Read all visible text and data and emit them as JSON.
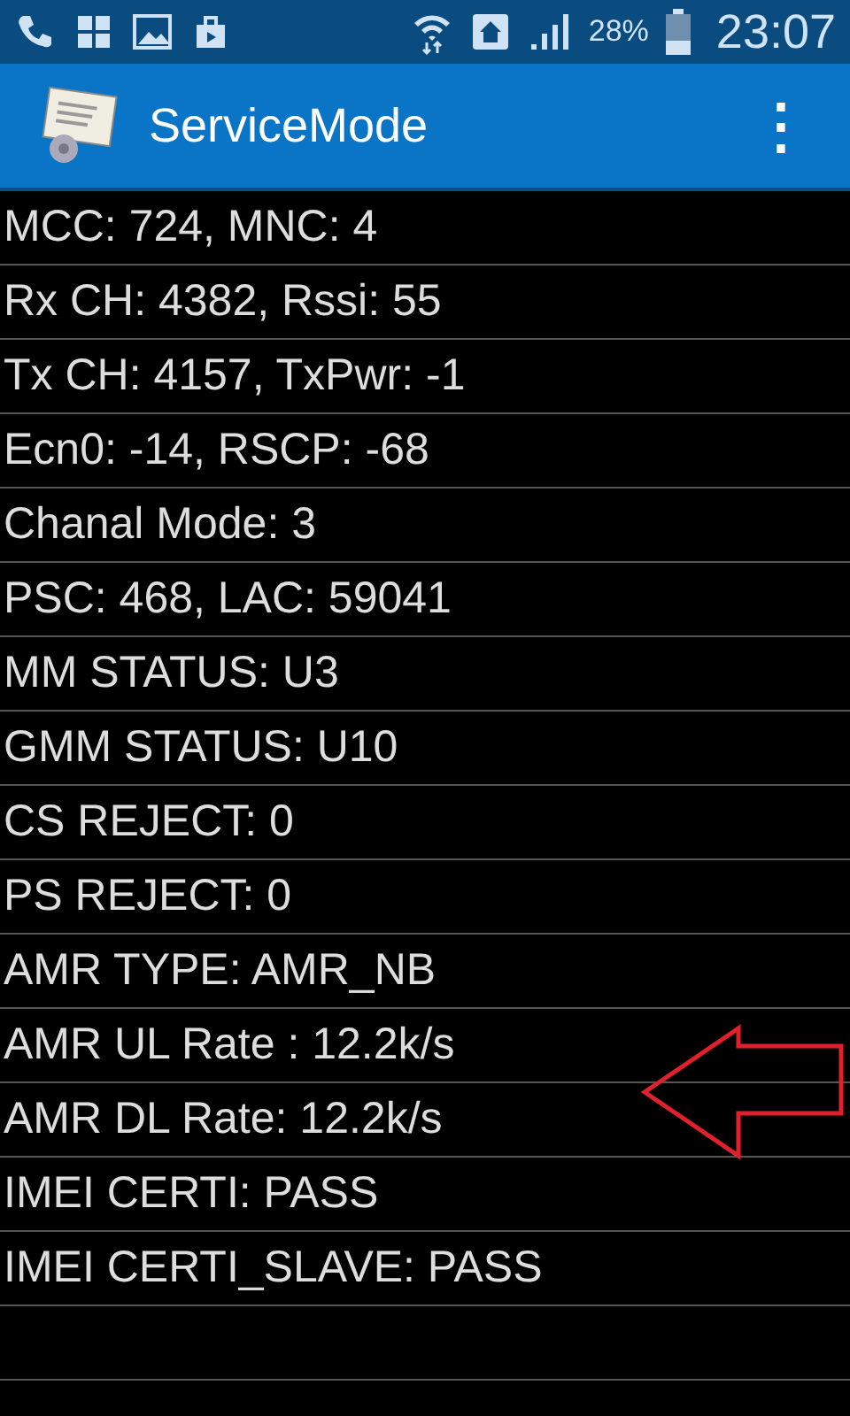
{
  "status_bar": {
    "battery_percent": "28%",
    "time": "23:07"
  },
  "app_bar": {
    "title": "ServiceMode",
    "menu": "⋮"
  },
  "rows": [
    "MCC: 724, MNC: 4",
    "Rx CH: 4382, Rssi: 55",
    "Tx CH: 4157, TxPwr: -1",
    "Ecn0: -14, RSCP: -68",
    "Chanal Mode: 3",
    "PSC: 468, LAC: 59041",
    "MM STATUS: U3",
    "GMM STATUS: U10",
    "CS REJECT: 0",
    "PS REJECT: 0",
    "AMR TYPE: AMR_NB",
    "AMR UL Rate : 12.2k/s",
    "AMR DL Rate: 12.2k/s",
    "IMEI CERTI: PASS",
    "IMEI CERTI_SLAVE: PASS"
  ]
}
